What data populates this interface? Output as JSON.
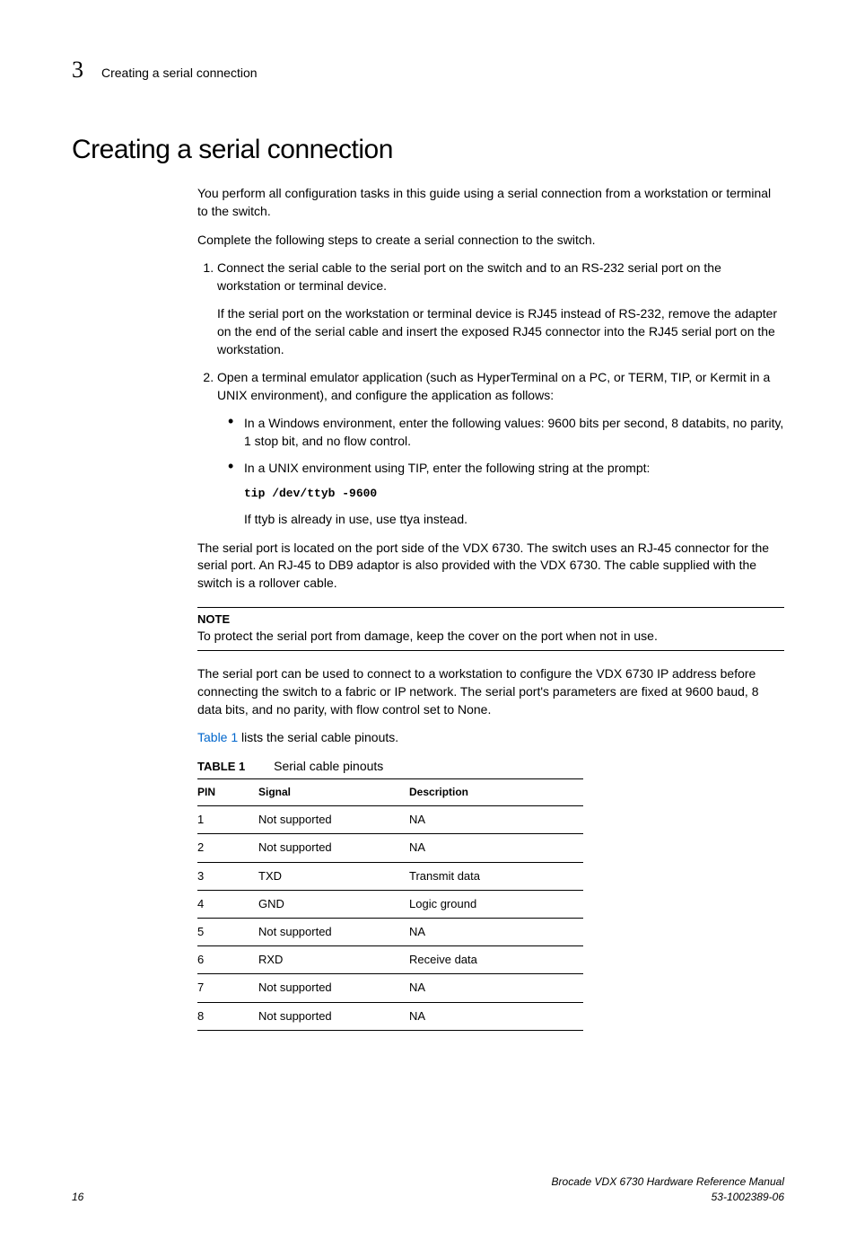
{
  "header": {
    "chapter_num": "3",
    "title": "Creating a serial connection"
  },
  "heading": "Creating a serial connection",
  "intro_p1": "You perform all configuration tasks in this guide using a serial connection from a workstation or terminal to the switch.",
  "intro_p2": "Complete the following steps to create a serial connection to the switch.",
  "step1_main": "Connect the serial cable to the serial port on the switch and to an RS-232 serial port on the workstation or terminal device.",
  "step1_sub": "If the serial port on the workstation or terminal device is RJ45 instead of RS-232, remove the adapter on the end of the serial cable and insert the exposed RJ45 connector into the RJ45 serial port on the workstation.",
  "step2_main": "Open a terminal emulator application (such as HyperTerminal on a PC, or TERM, TIP, or Kermit in a UNIX environment), and configure the application as follows:",
  "step2_bullet1": "In a Windows environment, enter the following values: 9600 bits per second, 8 databits, no parity, 1 stop bit, and no flow control.",
  "step2_bullet2": "In a UNIX environment using TIP, enter the following string at the prompt:",
  "step2_code": "tip /dev/ttyb -9600",
  "step2_bullet2_after": "If ttyb is already in use, use ttya instead.",
  "after_steps_p": "The serial port is located on the port side of the VDX 6730. The switch uses an RJ-45 connector for the serial port. An RJ-45 to DB9 adaptor is also provided with the VDX 6730. The cable supplied with the switch is a rollover cable.",
  "note_label": "NOTE",
  "note_text": "To protect the serial port from damage, keep the cover on the port when not in use.",
  "after_note_p": "The serial port can be used to connect to a workstation to configure the VDX 6730 IP address before connecting the switch to a fabric or IP network. The serial port's parameters are fixed at 9600 baud, 8 data bits, and no parity, with flow control set to None.",
  "table_ref_link": "Table 1",
  "table_ref_rest": " lists the serial cable pinouts.",
  "table_label": "TABLE 1",
  "table_title": "Serial cable pinouts",
  "table_headers": {
    "c1": "PIN",
    "c2": "Signal",
    "c3": "Description"
  },
  "rows": [
    {
      "pin": "1",
      "signal": "Not supported",
      "desc": "NA"
    },
    {
      "pin": "2",
      "signal": "Not supported",
      "desc": "NA"
    },
    {
      "pin": "3",
      "signal": "TXD",
      "desc": "Transmit data"
    },
    {
      "pin": "4",
      "signal": "GND",
      "desc": "Logic ground"
    },
    {
      "pin": "5",
      "signal": "Not supported",
      "desc": "NA"
    },
    {
      "pin": "6",
      "signal": "RXD",
      "desc": "Receive data"
    },
    {
      "pin": "7",
      "signal": "Not supported",
      "desc": "NA"
    },
    {
      "pin": "8",
      "signal": "Not supported",
      "desc": "NA"
    }
  ],
  "footer": {
    "page_num": "16",
    "manual_title": "Brocade VDX 6730 Hardware Reference Manual",
    "doc_num": "53-1002389-06"
  }
}
